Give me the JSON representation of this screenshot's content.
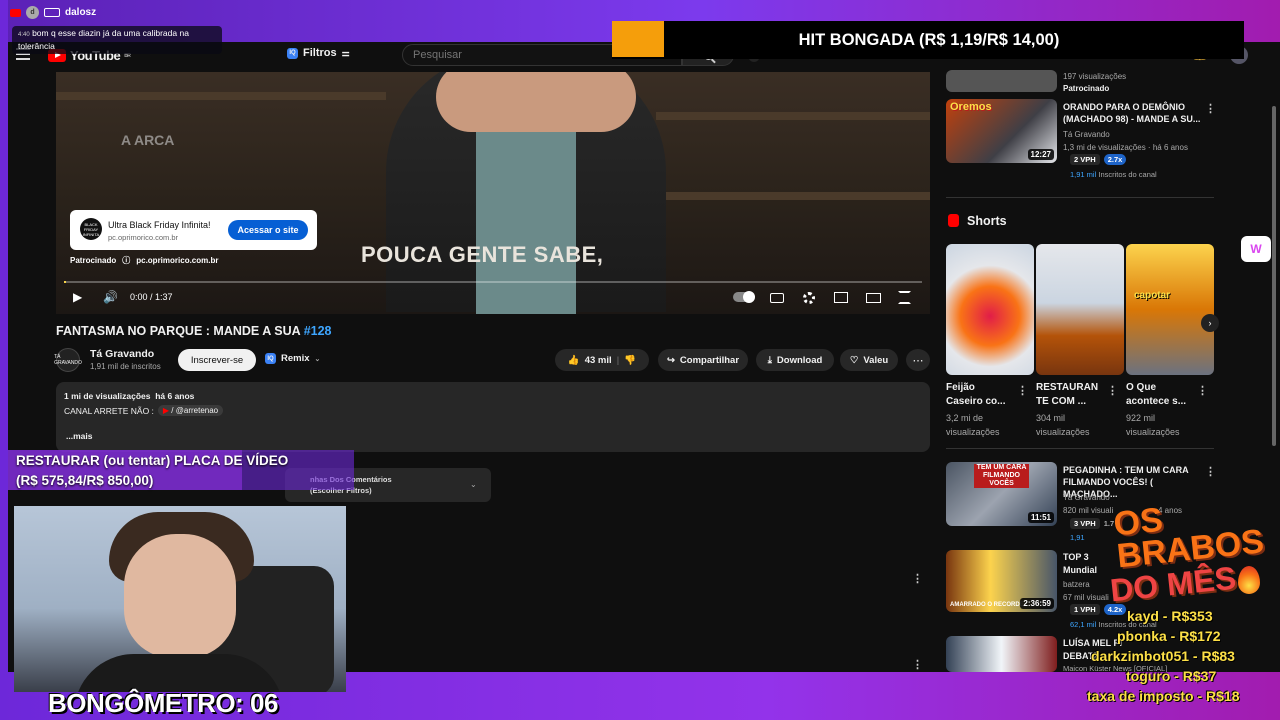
{
  "chat": {
    "user": "dalosz",
    "time": "4:40",
    "message": "bom q esse diazin já da uma calibrada na tolerância"
  },
  "hit_bar": {
    "text": "HIT BONGADA (R$ 1,19/R$ 14,00)"
  },
  "header": {
    "logo": "YouTube",
    "region": "BR",
    "filter_label": "Filtros",
    "search_placeholder": "Pesquisar"
  },
  "video": {
    "subtitle": "POUCA GENTE SABE,",
    "background_sign": "A ARCA",
    "ad_logo_text": "BLACK FRIDAY INFINITA",
    "ad_title": "Ultra Black Friday Infinita!",
    "ad_url": "pc.oprimorico.com.br",
    "ad_button": "Acessar o site",
    "sponsored_label": "Patrocinado",
    "sponsored_url": "pc.oprimorico.com.br",
    "time": "0:00 / 1:37",
    "progress": 0.0
  },
  "title": {
    "text": "FANTASMA NO PARQUE : MANDE A SUA ",
    "tag": "#128"
  },
  "channel": {
    "name": "Tá Gravando",
    "subs": "1,91 mil de inscritos",
    "avatar_text": "TÁ GRAVANDO"
  },
  "actions": {
    "subscribe": "Inscrever-se",
    "remix": "Remix",
    "likes": "43 mil",
    "share": "Compartilhar",
    "download": "Download",
    "valeu": "Valeu"
  },
  "description": {
    "views": "1 mi de visualizações",
    "ago": "há 6 anos",
    "line2": "CANAL ARRETE NÃO :",
    "handle": "/ @arretenao",
    "more": "...mais"
  },
  "comments_filter": {
    "line1": "nhas Dos Comentários",
    "line2": "(Escolher Filtros)"
  },
  "goal": {
    "line1": "RESTAURAR (ou tentar) PLACA DE VÍDEO",
    "line2": "(R$ 575,84/R$ 850,00)",
    "progress": 0.677
  },
  "bongometro": "BONGÔMETRO: 06",
  "sidebar": {
    "top_item": {
      "views": "197 visualizações",
      "sponsored": "Patrocinado"
    },
    "item1": {
      "title": "ORANDO PARA O DEMÔNIO (MACHADO 98) - MANDE A SU...",
      "channel": "Tá Gravando",
      "meta": "1,3 mi de visualizações · há 6 anos",
      "vph": "2 VPH",
      "mult": "2.7x",
      "subs": "1,91 mil",
      "subs_suffix": "Inscritos do canal",
      "duration": "12:27",
      "thumb_text": "Oremos"
    },
    "shorts_label": "Shorts",
    "shorts": [
      {
        "title": "Feijão Caseiro co...",
        "views": "3,2 mi de visualizações"
      },
      {
        "title": "RESTAURAN TE COM ...",
        "views": "304 mil visualizações"
      },
      {
        "title": "O Que acontece s...",
        "views": "922 mil visualizações",
        "thumb_text": "capotar"
      }
    ],
    "item2": {
      "title": "PEGADINHA : TEM UM CARA FILMANDO VOCÊS! ( MACHADO...",
      "channel": "Tá Gravando",
      "meta": "820 mil visuali",
      "ago": "4 anos",
      "vph": "3 VPH",
      "mult": "1.7",
      "subs": "1,91",
      "duration": "11:51",
      "thumb_text": "TEM UM CARA FILMANDO VOCÊS"
    },
    "item3": {
      "title": "TOP 3",
      "title2": "Mundial",
      "channel": "batzera",
      "meta": "67 mil visuali",
      "vph": "1 VPH",
      "mult": "4.2x",
      "subs": "62,1 mil",
      "subs_suffix": "Inscritos do canal",
      "duration": "2:36:59",
      "thumb_text": "AMARRADO O RECORDE"
    },
    "item4": {
      "title": "LUÍSA MEL PI",
      "title2": "DEBATE",
      "channel": "Maicon Küster News [OFICIAL]"
    }
  },
  "bravos": {
    "line1": "OS BRABOS",
    "line2": "DO MÊS",
    "donors": [
      "kayd - R$353",
      "pbonka - R$172",
      "darkzimbot051 - R$83",
      "toguro - R$37",
      "taxa de imposto - R$18"
    ]
  }
}
